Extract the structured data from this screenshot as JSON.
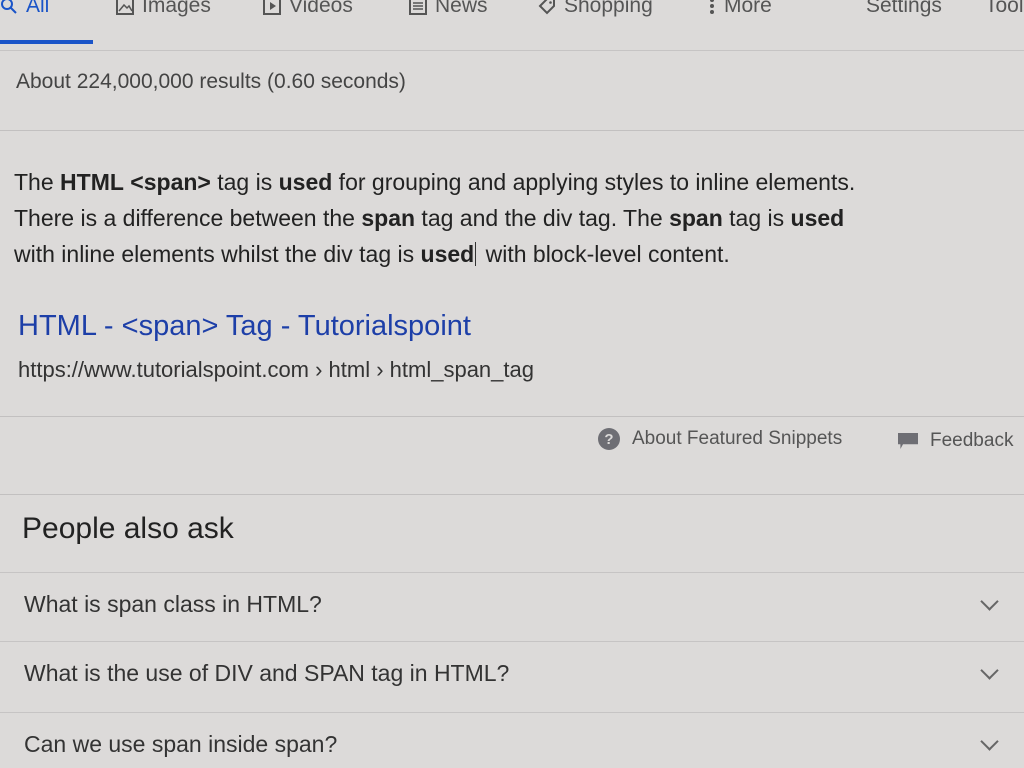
{
  "nav": {
    "tabs": [
      {
        "label": "All",
        "icon": "search-icon",
        "active": true
      },
      {
        "label": "Images",
        "icon": "image-icon"
      },
      {
        "label": "Videos",
        "icon": "play-icon"
      },
      {
        "label": "News",
        "icon": "newspaper-icon"
      },
      {
        "label": "Shopping",
        "icon": "tag-icon"
      },
      {
        "label": "More",
        "icon": "more-vertical-icon"
      }
    ],
    "settings": "Settings",
    "tools": "Tools"
  },
  "stats": "About 224,000,000 results (0.60 seconds)",
  "snippet": {
    "line1": [
      "The ",
      "HTML",
      " ",
      "<span>",
      " tag is ",
      "used",
      " for grouping and applying styles to inline elements."
    ],
    "line2": [
      "There is a difference between the ",
      "span",
      " tag and the div tag. The ",
      "span",
      " tag is ",
      "used"
    ],
    "line3": [
      "with inline elements whilst the div tag is ",
      "used",
      " with block-level content."
    ]
  },
  "result": {
    "title": "HTML - <span> Tag - Tutorialspoint",
    "url": "https://www.tutorialspoint.com › html › html_span_tag"
  },
  "footer": {
    "about_label": "About Featured Snippets",
    "feedback_label": "Feedback"
  },
  "paa": {
    "title": "People also ask",
    "questions": [
      "What is span class in HTML?",
      "What is the use of DIV and SPAN tag in HTML?",
      "Can we use span inside span?"
    ]
  },
  "colors": {
    "accent": "#1a54c8",
    "link": "#1d3fa8"
  }
}
